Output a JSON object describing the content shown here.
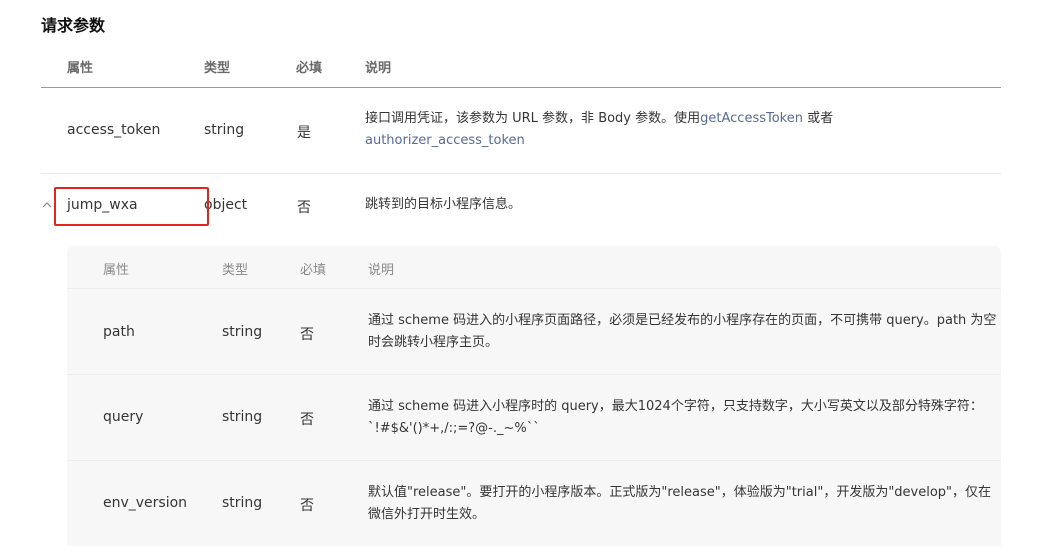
{
  "section": {
    "title": "请求参数"
  },
  "columns": {
    "attr": "属性",
    "type": "类型",
    "required": "必填",
    "desc": "说明"
  },
  "rows": [
    {
      "name": "access_token",
      "type": "string",
      "required": "是",
      "desc_pre": "接口调用凭证，该参数为 URL 参数，非 Body 参数。使用",
      "desc_link1": "getAccessToken",
      "desc_mid": " 或者 ",
      "desc_link2": "authorizer_access_token"
    },
    {
      "name": "jump_wxa",
      "type": "object",
      "required": "否",
      "desc": "跳转到的目标小程序信息。",
      "expanded": true
    }
  ],
  "nested": {
    "columns": {
      "attr": "属性",
      "type": "类型",
      "required": "必填",
      "desc": "说明"
    },
    "rows": [
      {
        "name": "path",
        "type": "string",
        "required": "否",
        "desc": "通过 scheme 码进入的小程序页面路径，必须是已经发布的小程序存在的页面，不可携带 query。path 为空时会跳转小程序主页。"
      },
      {
        "name": "query",
        "type": "string",
        "required": "否",
        "desc": "通过 scheme 码进入小程序时的 query，最大1024个字符，只支持数字，大小写英文以及部分特殊字符：`!#$&'()*+,/:;=?@-._~%``"
      },
      {
        "name": "env_version",
        "type": "string",
        "required": "否",
        "desc": "默认值\"release\"。要打开的小程序版本。正式版为\"release\"，体验版为\"trial\"，开发版为\"develop\"，仅在微信外打开时生效。"
      }
    ]
  },
  "colors": {
    "link": "#576b95",
    "highlight_border": "#e0251d",
    "nested_bg": "#f7f7f7"
  },
  "icons": {
    "toggle": "chevron-up-icon"
  }
}
